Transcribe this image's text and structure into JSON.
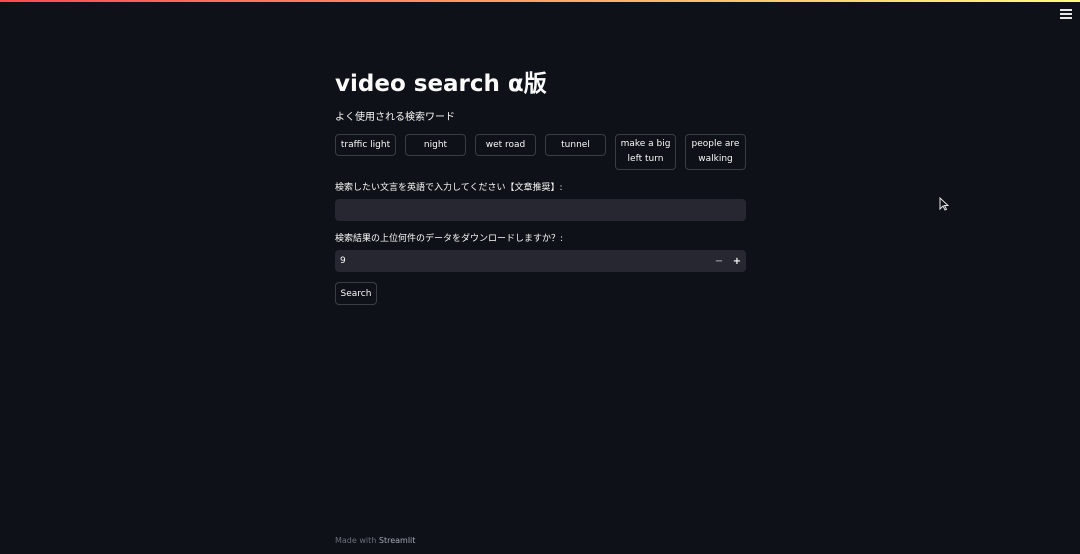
{
  "app": {
    "title": "video search α版",
    "menu_icon": "hamburger-menu-icon",
    "accent_gradient": [
      "#ff4b4b",
      "#fffd80"
    ],
    "background": "#0e1117"
  },
  "suggestions": {
    "header": "よく使用される検索ワード",
    "buttons": [
      {
        "label": "traffic light"
      },
      {
        "label": "night"
      },
      {
        "label": "wet road"
      },
      {
        "label": "tunnel"
      },
      {
        "label": "make a big left turn"
      },
      {
        "label": "people are walking"
      }
    ]
  },
  "text_query": {
    "label": "検索したい文言を英語で入力してください【文章推奨】:",
    "value": ""
  },
  "download_count": {
    "label": "検索結果の上位何件のデータをダウンロードしますか？:",
    "value": "9",
    "minus_symbol": "−",
    "plus_symbol": "+"
  },
  "search": {
    "label": "Search"
  },
  "footer": {
    "prefix": "Made with",
    "brand": "Streamlit"
  }
}
